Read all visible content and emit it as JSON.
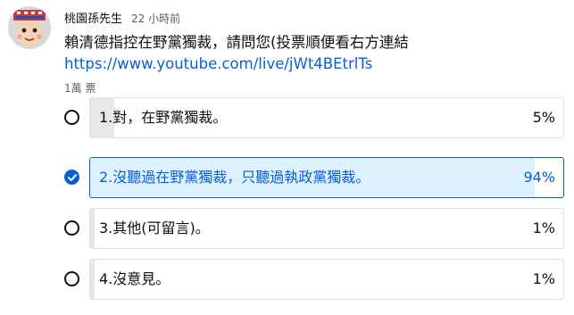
{
  "post": {
    "author": "桃園孫先生",
    "time": "22 小時前",
    "text": "賴清德指控在野黨獨裁，請問您(投票順便看右方連結",
    "link": "https://www.youtube.com/live/jWt4BEtrlTs",
    "vote_count": "1萬 票"
  },
  "poll": {
    "options": [
      {
        "label": "1.對，在野黨獨裁。",
        "percent_text": "5%",
        "percent": 5,
        "selected": false
      },
      {
        "label": "2.沒聽過在野黨獨裁，只聽過執政黨獨裁。",
        "percent_text": "94%",
        "percent": 94,
        "selected": true
      },
      {
        "label": "3.其他(可留言)。",
        "percent_text": "1%",
        "percent": 1,
        "selected": false
      },
      {
        "label": "4.沒意見。",
        "percent_text": "1%",
        "percent": 1,
        "selected": false
      }
    ]
  },
  "colors": {
    "accent": "#065fd4",
    "selected_fill": "#def1ff",
    "bar_fill": "#e8e8e8",
    "secondary_text": "#606060"
  },
  "icons": {
    "avatar": "cartoon-face-avatar",
    "selected_radio": "check-circle-icon",
    "unselected_radio": "radio-circle-icon"
  }
}
